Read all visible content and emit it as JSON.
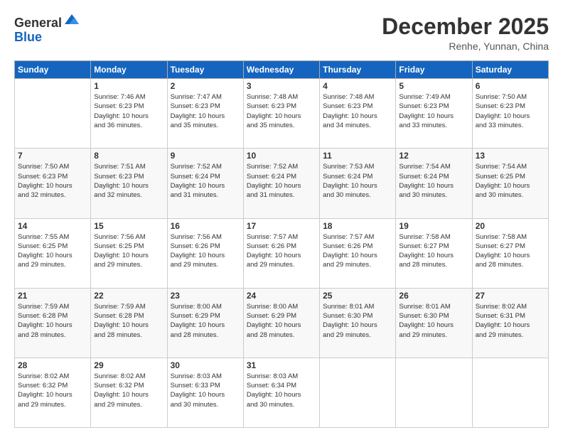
{
  "logo": {
    "line1": "General",
    "line2": "Blue"
  },
  "header": {
    "month": "December 2025",
    "location": "Renhe, Yunnan, China"
  },
  "weekdays": [
    "Sunday",
    "Monday",
    "Tuesday",
    "Wednesday",
    "Thursday",
    "Friday",
    "Saturday"
  ],
  "weeks": [
    [
      {
        "day": null,
        "info": null
      },
      {
        "day": "1",
        "info": "Sunrise: 7:46 AM\nSunset: 6:23 PM\nDaylight: 10 hours\nand 36 minutes."
      },
      {
        "day": "2",
        "info": "Sunrise: 7:47 AM\nSunset: 6:23 PM\nDaylight: 10 hours\nand 35 minutes."
      },
      {
        "day": "3",
        "info": "Sunrise: 7:48 AM\nSunset: 6:23 PM\nDaylight: 10 hours\nand 35 minutes."
      },
      {
        "day": "4",
        "info": "Sunrise: 7:48 AM\nSunset: 6:23 PM\nDaylight: 10 hours\nand 34 minutes."
      },
      {
        "day": "5",
        "info": "Sunrise: 7:49 AM\nSunset: 6:23 PM\nDaylight: 10 hours\nand 33 minutes."
      },
      {
        "day": "6",
        "info": "Sunrise: 7:50 AM\nSunset: 6:23 PM\nDaylight: 10 hours\nand 33 minutes."
      }
    ],
    [
      {
        "day": "7",
        "info": "Sunrise: 7:50 AM\nSunset: 6:23 PM\nDaylight: 10 hours\nand 32 minutes."
      },
      {
        "day": "8",
        "info": "Sunrise: 7:51 AM\nSunset: 6:23 PM\nDaylight: 10 hours\nand 32 minutes."
      },
      {
        "day": "9",
        "info": "Sunrise: 7:52 AM\nSunset: 6:24 PM\nDaylight: 10 hours\nand 31 minutes."
      },
      {
        "day": "10",
        "info": "Sunrise: 7:52 AM\nSunset: 6:24 PM\nDaylight: 10 hours\nand 31 minutes."
      },
      {
        "day": "11",
        "info": "Sunrise: 7:53 AM\nSunset: 6:24 PM\nDaylight: 10 hours\nand 30 minutes."
      },
      {
        "day": "12",
        "info": "Sunrise: 7:54 AM\nSunset: 6:24 PM\nDaylight: 10 hours\nand 30 minutes."
      },
      {
        "day": "13",
        "info": "Sunrise: 7:54 AM\nSunset: 6:25 PM\nDaylight: 10 hours\nand 30 minutes."
      }
    ],
    [
      {
        "day": "14",
        "info": "Sunrise: 7:55 AM\nSunset: 6:25 PM\nDaylight: 10 hours\nand 29 minutes."
      },
      {
        "day": "15",
        "info": "Sunrise: 7:56 AM\nSunset: 6:25 PM\nDaylight: 10 hours\nand 29 minutes."
      },
      {
        "day": "16",
        "info": "Sunrise: 7:56 AM\nSunset: 6:26 PM\nDaylight: 10 hours\nand 29 minutes."
      },
      {
        "day": "17",
        "info": "Sunrise: 7:57 AM\nSunset: 6:26 PM\nDaylight: 10 hours\nand 29 minutes."
      },
      {
        "day": "18",
        "info": "Sunrise: 7:57 AM\nSunset: 6:26 PM\nDaylight: 10 hours\nand 29 minutes."
      },
      {
        "day": "19",
        "info": "Sunrise: 7:58 AM\nSunset: 6:27 PM\nDaylight: 10 hours\nand 28 minutes."
      },
      {
        "day": "20",
        "info": "Sunrise: 7:58 AM\nSunset: 6:27 PM\nDaylight: 10 hours\nand 28 minutes."
      }
    ],
    [
      {
        "day": "21",
        "info": "Sunrise: 7:59 AM\nSunset: 6:28 PM\nDaylight: 10 hours\nand 28 minutes."
      },
      {
        "day": "22",
        "info": "Sunrise: 7:59 AM\nSunset: 6:28 PM\nDaylight: 10 hours\nand 28 minutes."
      },
      {
        "day": "23",
        "info": "Sunrise: 8:00 AM\nSunset: 6:29 PM\nDaylight: 10 hours\nand 28 minutes."
      },
      {
        "day": "24",
        "info": "Sunrise: 8:00 AM\nSunset: 6:29 PM\nDaylight: 10 hours\nand 28 minutes."
      },
      {
        "day": "25",
        "info": "Sunrise: 8:01 AM\nSunset: 6:30 PM\nDaylight: 10 hours\nand 29 minutes."
      },
      {
        "day": "26",
        "info": "Sunrise: 8:01 AM\nSunset: 6:30 PM\nDaylight: 10 hours\nand 29 minutes."
      },
      {
        "day": "27",
        "info": "Sunrise: 8:02 AM\nSunset: 6:31 PM\nDaylight: 10 hours\nand 29 minutes."
      }
    ],
    [
      {
        "day": "28",
        "info": "Sunrise: 8:02 AM\nSunset: 6:32 PM\nDaylight: 10 hours\nand 29 minutes."
      },
      {
        "day": "29",
        "info": "Sunrise: 8:02 AM\nSunset: 6:32 PM\nDaylight: 10 hours\nand 29 minutes."
      },
      {
        "day": "30",
        "info": "Sunrise: 8:03 AM\nSunset: 6:33 PM\nDaylight: 10 hours\nand 30 minutes."
      },
      {
        "day": "31",
        "info": "Sunrise: 8:03 AM\nSunset: 6:34 PM\nDaylight: 10 hours\nand 30 minutes."
      },
      {
        "day": null,
        "info": null
      },
      {
        "day": null,
        "info": null
      },
      {
        "day": null,
        "info": null
      }
    ]
  ]
}
